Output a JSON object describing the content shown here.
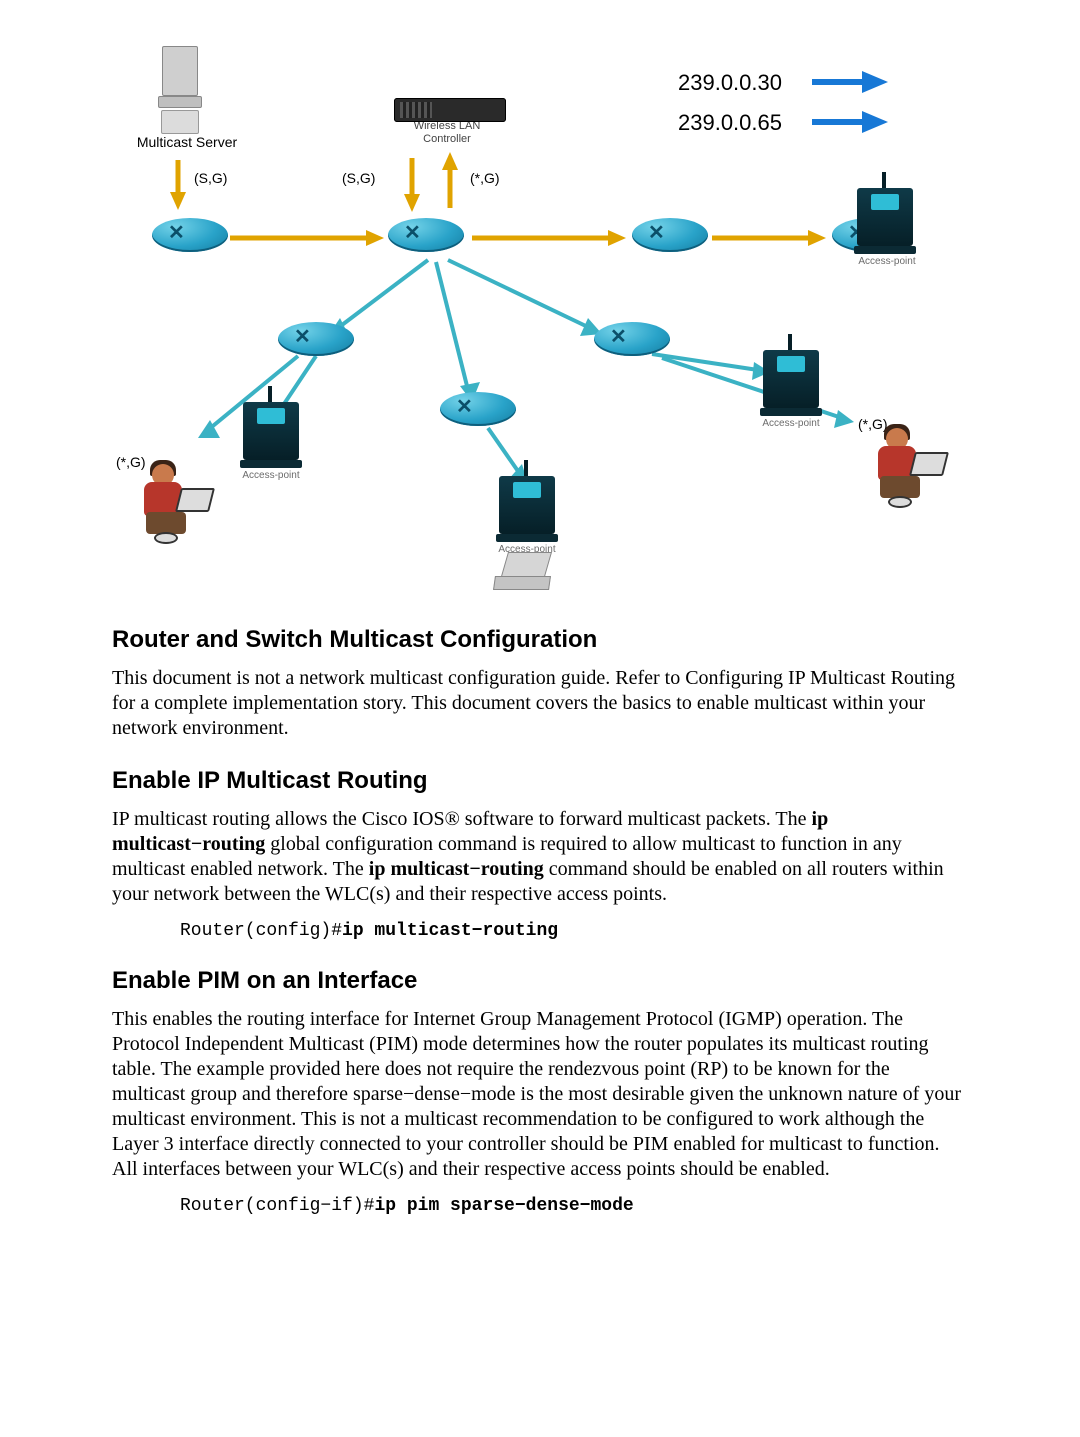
{
  "diagram": {
    "server_label": "Multicast Server",
    "wlc_line1": "Wireless LAN",
    "wlc_line2": "Controller",
    "addr1": "239.0.0.30",
    "addr2": "239.0.0.65",
    "sg1": "(S,G)",
    "sg2": "(S,G)",
    "star_g_top": "(*,G)",
    "star_g_left": "(*,G)",
    "star_g_right": "(*,G)",
    "ap_label": "Access-point"
  },
  "sec1": {
    "title": "Router and Switch Multicast Configuration",
    "para": "This document is not a network multicast configuration guide. Refer to Configuring IP Multicast Routing for a complete implementation story. This document covers the basics to enable multicast within your network environment."
  },
  "sec2": {
    "title": "Enable IP Multicast Routing",
    "para_a": "IP multicast routing allows the Cisco IOS® software to forward multicast packets. The ",
    "cmd_a": "ip multicast−routing",
    "para_b": " global configuration command is required to allow multicast to function in any multicast enabled network. The ",
    "cmd_b": "ip multicast−routing",
    "para_c": " command should be enabled on all routers within your network between the WLC(s) and their respective access points.",
    "code_prompt": "Router(config)#",
    "code_cmd": "ip multicast−routing"
  },
  "sec3": {
    "title": "Enable PIM on an Interface",
    "para": "This enables the routing interface for Internet Group Management Protocol (IGMP) operation. The Protocol Independent Multicast (PIM) mode determines how the router populates its multicast routing table. The example provided here does not require the rendezvous point (RP) to be known for the multicast group and therefore sparse−dense−mode is the most desirable given the unknown nature of your multicast environment. This is not a multicast recommendation to be configured to work although the Layer 3 interface directly connected to your controller should be PIM enabled for multicast to function. All interfaces between your WLC(s) and their respective access points should be enabled.",
    "code_prompt": "Router(config−if)#",
    "code_cmd": "ip pim sparse−dense−mode"
  }
}
